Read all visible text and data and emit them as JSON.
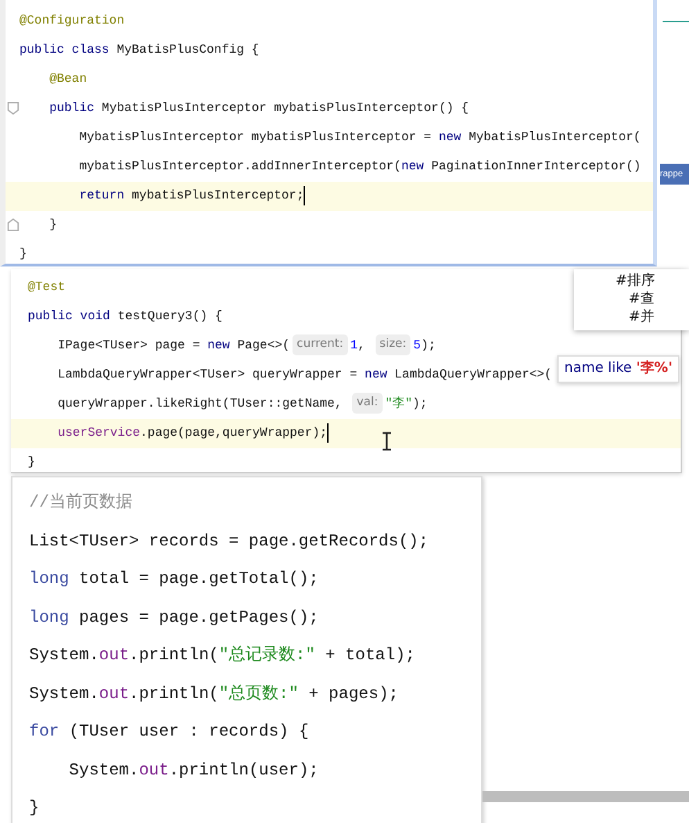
{
  "panels": [
    {
      "lines": [
        {
          "current": false,
          "tokens": [
            {
              "kind": "ann",
              "text": "@Configuration"
            }
          ]
        },
        {
          "current": false,
          "tokens": [
            {
              "kind": "kw",
              "text": "public class "
            },
            {
              "kind": "plain",
              "text": "MyBatisPlusConfig {"
            }
          ]
        },
        {
          "current": false,
          "tokens": [
            {
              "kind": "ann",
              "text": "    @Bean"
            }
          ]
        },
        {
          "current": false,
          "fold_open": true,
          "tokens": [
            {
              "kind": "kw",
              "text": "    public "
            },
            {
              "kind": "plain",
              "text": "MybatisPlusInterceptor mybatisPlusInterceptor() {"
            }
          ]
        },
        {
          "current": false,
          "tokens": [
            {
              "kind": "plain",
              "text": "        MybatisPlusInterceptor mybatisPlusInterceptor = "
            },
            {
              "kind": "kw",
              "text": "new "
            },
            {
              "kind": "plain",
              "text": "MybatisPlusInterceptor("
            }
          ]
        },
        {
          "current": false,
          "tokens": [
            {
              "kind": "plain",
              "text": "        mybatisPlusInterceptor.addInnerInterceptor("
            },
            {
              "kind": "kw",
              "text": "new "
            },
            {
              "kind": "plain",
              "text": "PaginationInnerInterceptor()"
            }
          ]
        },
        {
          "current": true,
          "tokens": [
            {
              "kind": "kw",
              "text": "        return "
            },
            {
              "kind": "plain",
              "text": "mybatisPlusInterceptor;"
            }
          ]
        },
        {
          "current": false,
          "fold_close": true,
          "tokens": [
            {
              "kind": "plain",
              "text": "    }"
            }
          ]
        },
        {
          "current": false,
          "tokens": [
            {
              "kind": "plain",
              "text": "}"
            }
          ]
        }
      ]
    },
    {
      "lines": [
        {
          "current": false,
          "tokens": [
            {
              "kind": "ann",
              "text": "@Test"
            }
          ]
        },
        {
          "current": false,
          "tokens": [
            {
              "kind": "kw",
              "text": "public void "
            },
            {
              "kind": "plain",
              "text": "testQuery3() {"
            }
          ]
        },
        {
          "current": false,
          "tokens": [
            {
              "kind": "plain",
              "text": "    IPage<TUser> page = "
            },
            {
              "kind": "kw",
              "text": "new "
            },
            {
              "kind": "plain",
              "text": "Page<>("
            },
            {
              "kind": "hint",
              "text": "current:"
            },
            {
              "kind": "num",
              "text": "1"
            },
            {
              "kind": "plain",
              "text": ", "
            },
            {
              "kind": "hint",
              "text": "size:"
            },
            {
              "kind": "num",
              "text": "5"
            },
            {
              "kind": "plain",
              "text": ");"
            }
          ]
        },
        {
          "current": false,
          "tokens": [
            {
              "kind": "plain",
              "text": "    LambdaQueryWrapper<TUser> queryWrapper = "
            },
            {
              "kind": "kw",
              "text": "new "
            },
            {
              "kind": "plain",
              "text": "LambdaQueryWrapper<>("
            }
          ]
        },
        {
          "current": false,
          "tokens": [
            {
              "kind": "plain",
              "text": "    queryWrapper.likeRight(TUser::getName, "
            },
            {
              "kind": "hint",
              "text": "val:"
            },
            {
              "kind": "str",
              "text": "\"李\""
            },
            {
              "kind": "plain",
              "text": ");"
            }
          ]
        },
        {
          "current": true,
          "tokens": [
            {
              "kind": "field",
              "text": "    userService"
            },
            {
              "kind": "plain",
              "text": ".page(page,queryWrapper);"
            }
          ]
        },
        {
          "current": false,
          "tokens": [
            {
              "kind": "plain",
              "text": "}"
            }
          ]
        }
      ]
    },
    {
      "lines": [
        {
          "tokens": [
            {
              "kind": "comment",
              "text": "//当前页数据"
            }
          ]
        },
        {
          "tokens": [
            {
              "kind": "plain",
              "text": "List<TUser> records = page.getRecords();"
            }
          ]
        },
        {
          "tokens": [
            {
              "kind": "kw2",
              "text": "long "
            },
            {
              "kind": "plain",
              "text": "total = page.getTotal();"
            }
          ]
        },
        {
          "tokens": [
            {
              "kind": "kw2",
              "text": "long "
            },
            {
              "kind": "plain",
              "text": "pages = page.getPages();"
            }
          ]
        },
        {
          "tokens": [
            {
              "kind": "plain",
              "text": "System."
            },
            {
              "kind": "field",
              "text": "out"
            },
            {
              "kind": "plain",
              "text": ".println("
            },
            {
              "kind": "str",
              "text": "\"总记录数:\""
            },
            {
              "kind": "plain",
              "text": " + total);"
            }
          ]
        },
        {
          "tokens": [
            {
              "kind": "plain",
              "text": "System."
            },
            {
              "kind": "field",
              "text": "out"
            },
            {
              "kind": "plain",
              "text": ".println("
            },
            {
              "kind": "str",
              "text": "\"总页数:\""
            },
            {
              "kind": "plain",
              "text": " + pages);"
            }
          ]
        },
        {
          "tokens": [
            {
              "kind": "kw2",
              "text": "for "
            },
            {
              "kind": "plain",
              "text": "(TUser user : records) {"
            }
          ]
        },
        {
          "tokens": [
            {
              "kind": "plain",
              "text": "    System."
            },
            {
              "kind": "field",
              "text": "out"
            },
            {
              "kind": "plain",
              "text": ".println(user);"
            }
          ]
        },
        {
          "tokens": [
            {
              "kind": "plain",
              "text": "}"
            }
          ]
        }
      ]
    }
  ],
  "tooltip": {
    "tokens": [
      {
        "kind": "kw",
        "text": "name like "
      },
      {
        "kind": "red",
        "text": "'李%'"
      }
    ]
  },
  "popup": {
    "lines": [
      "#排序",
      "   #查",
      "   #并"
    ]
  },
  "side_tag": "rappe"
}
